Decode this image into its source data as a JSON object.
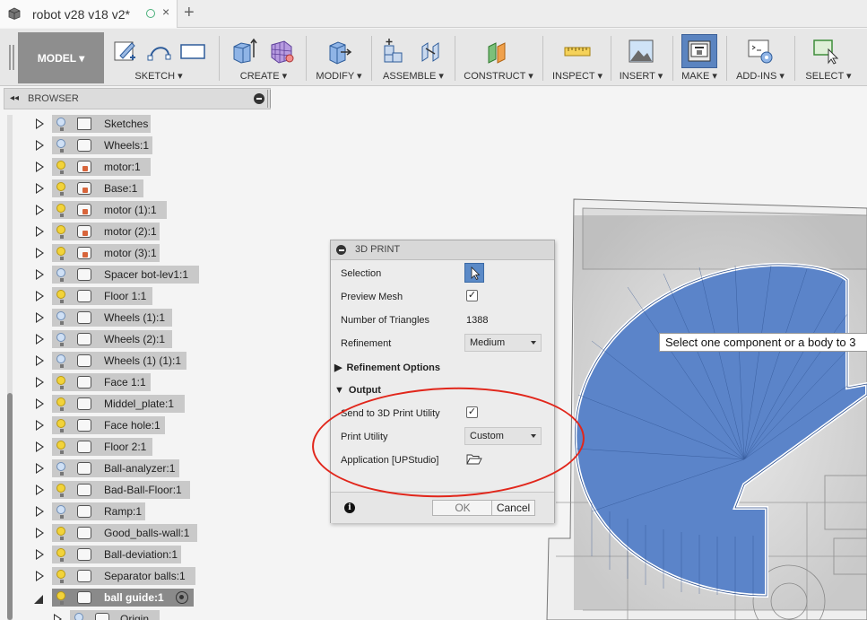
{
  "tabbar": {
    "doc_title": "robot v28 v18 v2*",
    "close_glyph": "×",
    "add_glyph": "+"
  },
  "toolbar": {
    "workspace": "MODEL ▾",
    "groups": [
      {
        "label": "SKETCH ▾"
      },
      {
        "label": "CREATE ▾"
      },
      {
        "label": "MODIFY ▾"
      },
      {
        "label": "ASSEMBLE ▾"
      },
      {
        "label": "CONSTRUCT ▾"
      },
      {
        "label": "INSPECT ▾"
      },
      {
        "label": "INSERT ▾"
      },
      {
        "label": "MAKE ▾"
      },
      {
        "label": "ADD-INS ▾"
      },
      {
        "label": "SELECT ▾"
      }
    ]
  },
  "browser": {
    "collapse_glyph": "◂◂",
    "title": "BROWSER",
    "items": [
      {
        "name": "Sketches",
        "light": "off",
        "icon": "folder"
      },
      {
        "name": "Wheels:1",
        "light": "off",
        "icon": "body"
      },
      {
        "name": "motor:1",
        "light": "on",
        "icon": "link"
      },
      {
        "name": "Base:1",
        "light": "on",
        "icon": "link"
      },
      {
        "name": "motor (1):1",
        "light": "on",
        "icon": "link"
      },
      {
        "name": "motor (2):1",
        "light": "on",
        "icon": "link"
      },
      {
        "name": "motor (3):1",
        "light": "on",
        "icon": "link"
      },
      {
        "name": "Spacer bot-lev1:1",
        "light": "off",
        "icon": "body"
      },
      {
        "name": "Floor 1:1",
        "light": "on",
        "icon": "body"
      },
      {
        "name": "Wheels (1):1",
        "light": "off",
        "icon": "body"
      },
      {
        "name": "Wheels (2):1",
        "light": "off",
        "icon": "body"
      },
      {
        "name": "Wheels (1) (1):1",
        "light": "off",
        "icon": "body"
      },
      {
        "name": "Face 1:1",
        "light": "on",
        "icon": "body"
      },
      {
        "name": "Middel_plate:1",
        "light": "on",
        "icon": "body"
      },
      {
        "name": "Face hole:1",
        "light": "on",
        "icon": "body"
      },
      {
        "name": "Floor 2:1",
        "light": "on",
        "icon": "body"
      },
      {
        "name": "Ball-analyzer:1",
        "light": "off",
        "icon": "body"
      },
      {
        "name": "Bad-Ball-Floor:1",
        "light": "on",
        "icon": "body"
      },
      {
        "name": "Ramp:1",
        "light": "off",
        "icon": "body"
      },
      {
        "name": "Good_balls-wall:1",
        "light": "on",
        "icon": "body"
      },
      {
        "name": "Ball-deviation:1",
        "light": "on",
        "icon": "body"
      },
      {
        "name": "Separator balls:1",
        "light": "on",
        "icon": "body"
      },
      {
        "name": "ball guide:1",
        "light": "on",
        "icon": "body",
        "active": true
      },
      {
        "name": "Origin",
        "light": "off",
        "icon": "body",
        "child": true
      }
    ]
  },
  "dialog": {
    "title": "3D PRINT",
    "selection_label": "Selection",
    "preview_label": "Preview Mesh",
    "preview_checked": "✓",
    "triangles_label": "Number of Triangles",
    "triangles_value": "1388",
    "refinement_label": "Refinement",
    "refinement_value": "Medium",
    "refinement_options_label": "Refinement Options",
    "output_label": "Output",
    "send_label": "Send to 3D Print Utility",
    "send_checked": "✓",
    "utility_label": "Print Utility",
    "utility_value": "Custom",
    "application_label": "Application [UPStudio]",
    "info_glyph": "i",
    "ok_label": "OK",
    "cancel_label": "Cancel"
  },
  "viewport": {
    "tooltip": "Select one component or a body to 3"
  },
  "colors": {
    "model_blue": "#5b84c9",
    "annotation_red": "#e1261b",
    "selection_blue": "#5b8ac7"
  }
}
